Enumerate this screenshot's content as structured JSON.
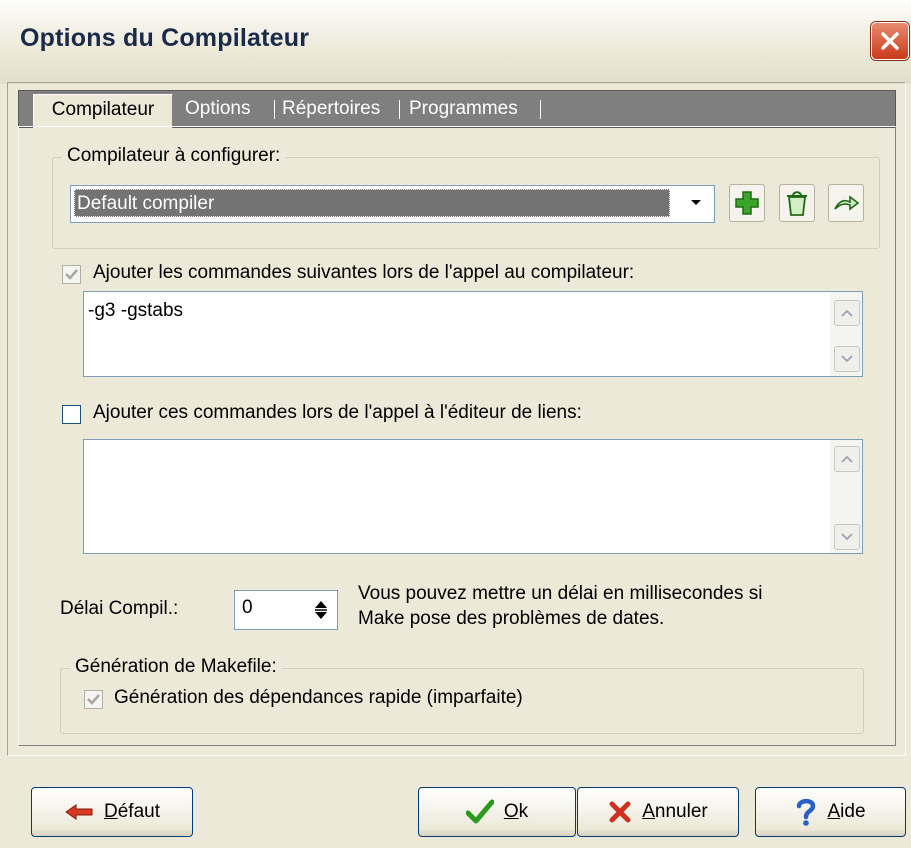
{
  "window": {
    "title": "Options du Compilateur"
  },
  "tabs": [
    {
      "label": "Compilateur",
      "active": true
    },
    {
      "label": "Options",
      "active": false
    },
    {
      "label": "Répertoires",
      "active": false
    },
    {
      "label": "Programmes",
      "active": false
    }
  ],
  "compiler_group": {
    "label": "Compilateur à configurer:",
    "selected_compiler": "Default compiler",
    "tools": [
      {
        "name": "add",
        "icon": "plus-icon",
        "color": "#2a9a1f"
      },
      {
        "name": "delete",
        "icon": "trash-icon",
        "color": "#2a9a1f"
      },
      {
        "name": "rename",
        "icon": "arrow-icon",
        "color": "#2a9a1f"
      }
    ]
  },
  "compiler_commands": {
    "checked": true,
    "label": "Ajouter les commandes suivantes lors de l'appel au compilateur:",
    "value": "-g3 -gstabs"
  },
  "linker_commands": {
    "checked": false,
    "label": "Ajouter ces commandes lors de l'appel à l'éditeur de liens:",
    "value": ""
  },
  "delay": {
    "label": "Délai Compil.:",
    "value": "0",
    "hint_line1": "Vous pouvez mettre un délai en millisecondes si",
    "hint_line2": "Make pose des problèmes de dates."
  },
  "makefile_group": {
    "label": "Génération de Makefile:",
    "fast_deps_checked": true,
    "fast_deps_label": "Génération des dépendances rapide (imparfaite)"
  },
  "buttons": {
    "default": {
      "accel": "D",
      "rest": "éfaut",
      "icon": "arrow-left-icon",
      "color": "#d03020"
    },
    "ok": {
      "accel": "O",
      "rest": "k",
      "icon": "checkmark-icon",
      "color": "#2a9a1f"
    },
    "cancel": {
      "accel": "A",
      "rest": "nnuler",
      "icon": "x-icon",
      "color": "#d03020"
    },
    "help": {
      "accel": "A",
      "rest": "ide",
      "icon": "question-icon",
      "color": "#2a5ec8"
    }
  }
}
